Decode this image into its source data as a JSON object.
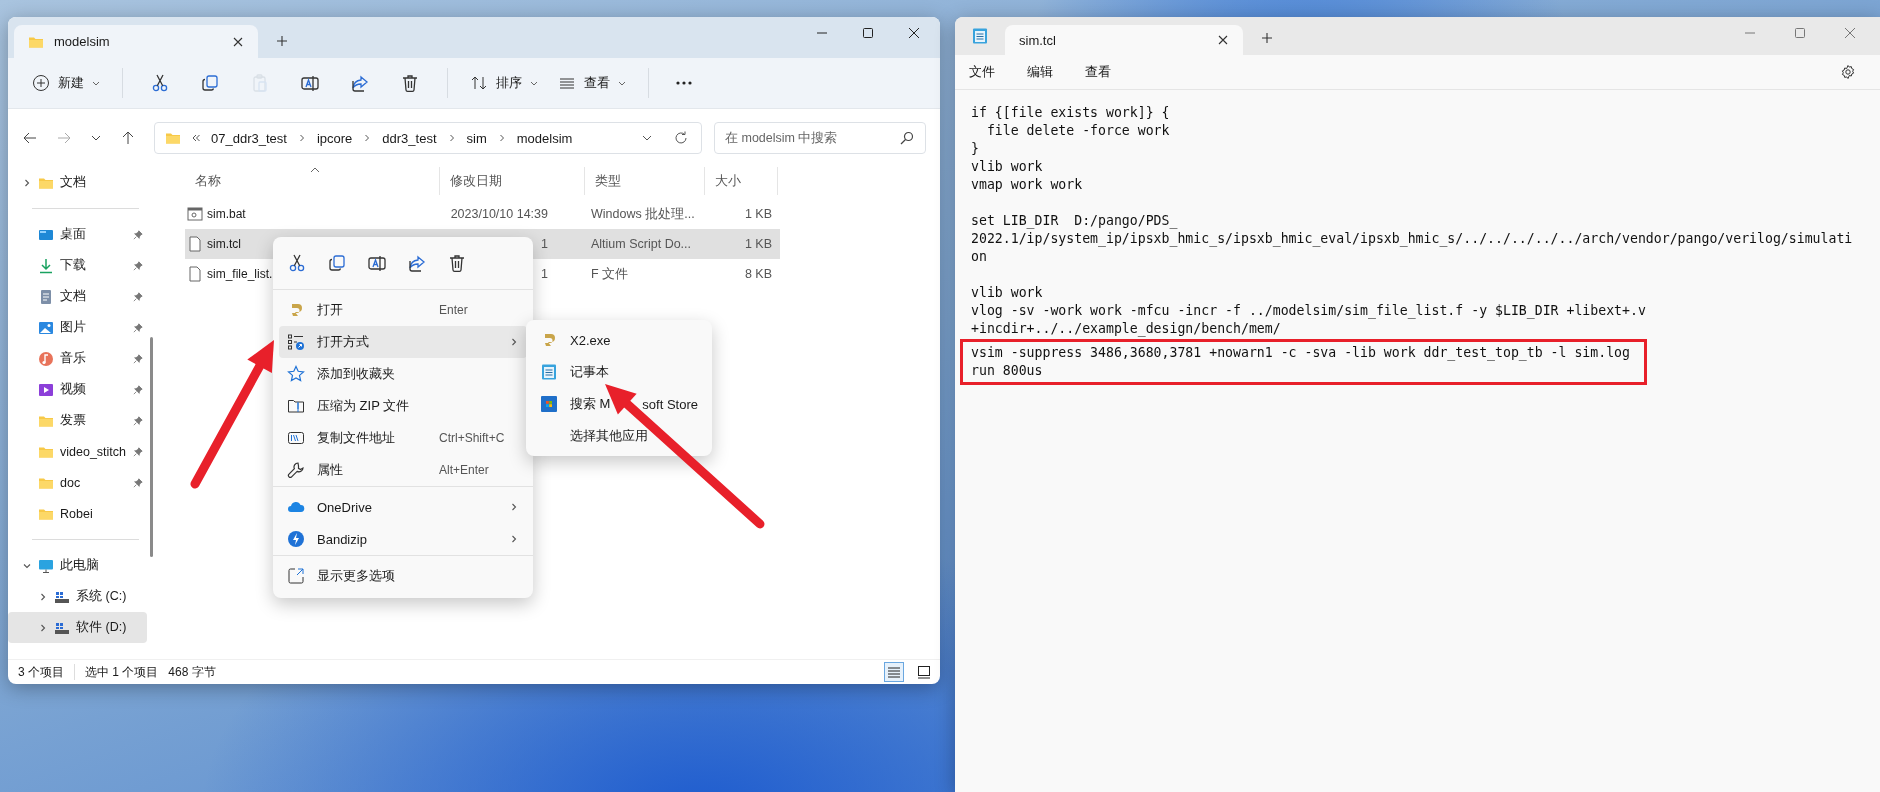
{
  "explorer": {
    "tab": {
      "title": "modelsim"
    },
    "toolbar": {
      "new_label": "新建",
      "actions": [
        {
          "kind": "cut",
          "disabled": false
        },
        {
          "kind": "copy",
          "disabled": false
        },
        {
          "kind": "paste",
          "disabled": true
        },
        {
          "kind": "rename",
          "disabled": false
        },
        {
          "kind": "share",
          "disabled": false
        },
        {
          "kind": "delete",
          "disabled": false
        }
      ],
      "sort_label": "排序",
      "view_label": "查看"
    },
    "breadcrumbs": [
      "07_ddr3_test",
      "ipcore",
      "ddr3_test",
      "sim",
      "modelsim"
    ],
    "search": {
      "placeholder": "在 modelsim 中搜索"
    },
    "sidebar": {
      "groups": [
        [
          {
            "label": "文档",
            "kind": "folder",
            "pinned": false,
            "expanded": false,
            "selected": false
          }
        ],
        [
          {
            "label": "桌面",
            "kind": "desktop",
            "pinned": true,
            "selected": false
          },
          {
            "label": "下载",
            "kind": "download",
            "pinned": true,
            "selected": false
          },
          {
            "label": "文档",
            "kind": "docs",
            "pinned": true,
            "selected": false
          },
          {
            "label": "图片",
            "kind": "pictures",
            "pinned": true,
            "selected": false
          },
          {
            "label": "音乐",
            "kind": "music",
            "pinned": true,
            "selected": false
          },
          {
            "label": "视频",
            "kind": "videos",
            "pinned": true,
            "selected": false
          },
          {
            "label": "发票",
            "kind": "folder",
            "pinned": true,
            "selected": false
          },
          {
            "label": "video_stitch",
            "kind": "folder",
            "pinned": true,
            "selected": false
          },
          {
            "label": "doc",
            "kind": "folder",
            "pinned": true,
            "selected": false
          },
          {
            "label": "Robei",
            "kind": "folder",
            "pinned": false,
            "selected": false
          }
        ],
        [
          {
            "label": "此电脑",
            "kind": "pc",
            "pinned": false,
            "expanded": true,
            "selected": false,
            "children": [
              {
                "label": "系统 (C:)",
                "kind": "drive",
                "pinned": false,
                "expanded": false,
                "selected": false
              },
              {
                "label": "软件 (D:)",
                "kind": "drive",
                "pinned": false,
                "expanded": false,
                "selected": true
              }
            ]
          }
        ]
      ]
    },
    "columns": [
      "名称",
      "修改日期",
      "类型",
      "大小"
    ],
    "files": [
      {
        "name": "sim.bat",
        "kind": "batch",
        "modified": "2023/10/10 14:39",
        "type": "Windows 批处理...",
        "size": "1 KB",
        "selected": false
      },
      {
        "name": "sim.tcl",
        "kind": "file",
        "modified": "1",
        "type": "Altium Script Do...",
        "size": "1 KB",
        "selected": true
      },
      {
        "name": "sim_file_list.",
        "kind": "file",
        "modified": "1",
        "type": "F 文件",
        "size": "8 KB",
        "selected": false
      }
    ],
    "status": {
      "count": "3 个项目",
      "selection": "选中 1 个项目",
      "bytes": "468 字节",
      "views": [
        {
          "kind": "details",
          "selected": true
        },
        {
          "kind": "tiles",
          "selected": false
        }
      ]
    },
    "context_menu": {
      "actions": [
        {
          "kind": "cut"
        },
        {
          "kind": "copy"
        },
        {
          "kind": "rename"
        },
        {
          "kind": "share"
        },
        {
          "kind": "delete"
        }
      ],
      "groups": [
        [
          {
            "label": "打开",
            "kind": "app",
            "shortcut": "Enter",
            "submenu": false,
            "selected": false
          },
          {
            "label": "打开方式",
            "kind": "openwith",
            "submenu": true,
            "selected": true
          },
          {
            "label": "添加到收藏夹",
            "kind": "star",
            "submenu": false,
            "selected": false
          },
          {
            "label": "压缩为 ZIP 文件",
            "kind": "zip",
            "submenu": false,
            "selected": false
          },
          {
            "label": "复制文件地址",
            "kind": "path",
            "shortcut": "Ctrl+Shift+C",
            "submenu": false,
            "selected": false
          },
          {
            "label": "属性",
            "kind": "wrench",
            "shortcut": "Alt+Enter",
            "submenu": false,
            "selected": false
          }
        ],
        [
          {
            "label": "OneDrive",
            "kind": "onedrive",
            "submenu": true,
            "selected": false
          },
          {
            "label": "Bandizip",
            "kind": "bandizip",
            "submenu": true,
            "selected": false
          }
        ],
        [
          {
            "label": "显示更多选项",
            "kind": "more",
            "submenu": false,
            "selected": false
          }
        ]
      ]
    },
    "submenu": {
      "items": [
        {
          "label": "X2.exe",
          "kind": "app"
        },
        {
          "label": "记事本",
          "kind": "notepad"
        },
        {
          "label": "搜索 M",
          "label_tail": "soft Store",
          "kind": "store"
        },
        {
          "label": "选择其他应用",
          "kind": "none"
        }
      ]
    }
  },
  "notepad": {
    "tab": {
      "title": "sim.tcl"
    },
    "menu": [
      "文件",
      "编辑",
      "查看"
    ],
    "blocks": [
      {
        "boxed": false,
        "lines": [
          "if {[file exists work]} {",
          "  file delete -force work",
          "}",
          "vlib work",
          "vmap work work"
        ]
      },
      {
        "boxed": false,
        "lines": [
          "set LIB_DIR  D:/pango/PDS_",
          "2022.1/ip/system_ip/ipsxb_hmic_s/ipsxb_hmic_eval/ipsxb_hmic_s/../../../../../arch/vendor/pango/verilog/simulati",
          "on"
        ]
      },
      {
        "boxed": false,
        "lines": [
          "vlib work",
          "vlog -sv -work work -mfcu -incr -f ../modelsim/sim_file_list.f -y $LIB_DIR +libext+.v",
          "+incdir+../../example_design/bench/mem/"
        ]
      },
      {
        "boxed": true,
        "lines": [
          "vsim -suppress 3486,3680,3781 +nowarn1 -c -sva -lib work ddr_test_top_tb -l sim.log",
          "run 800us"
        ]
      }
    ]
  }
}
